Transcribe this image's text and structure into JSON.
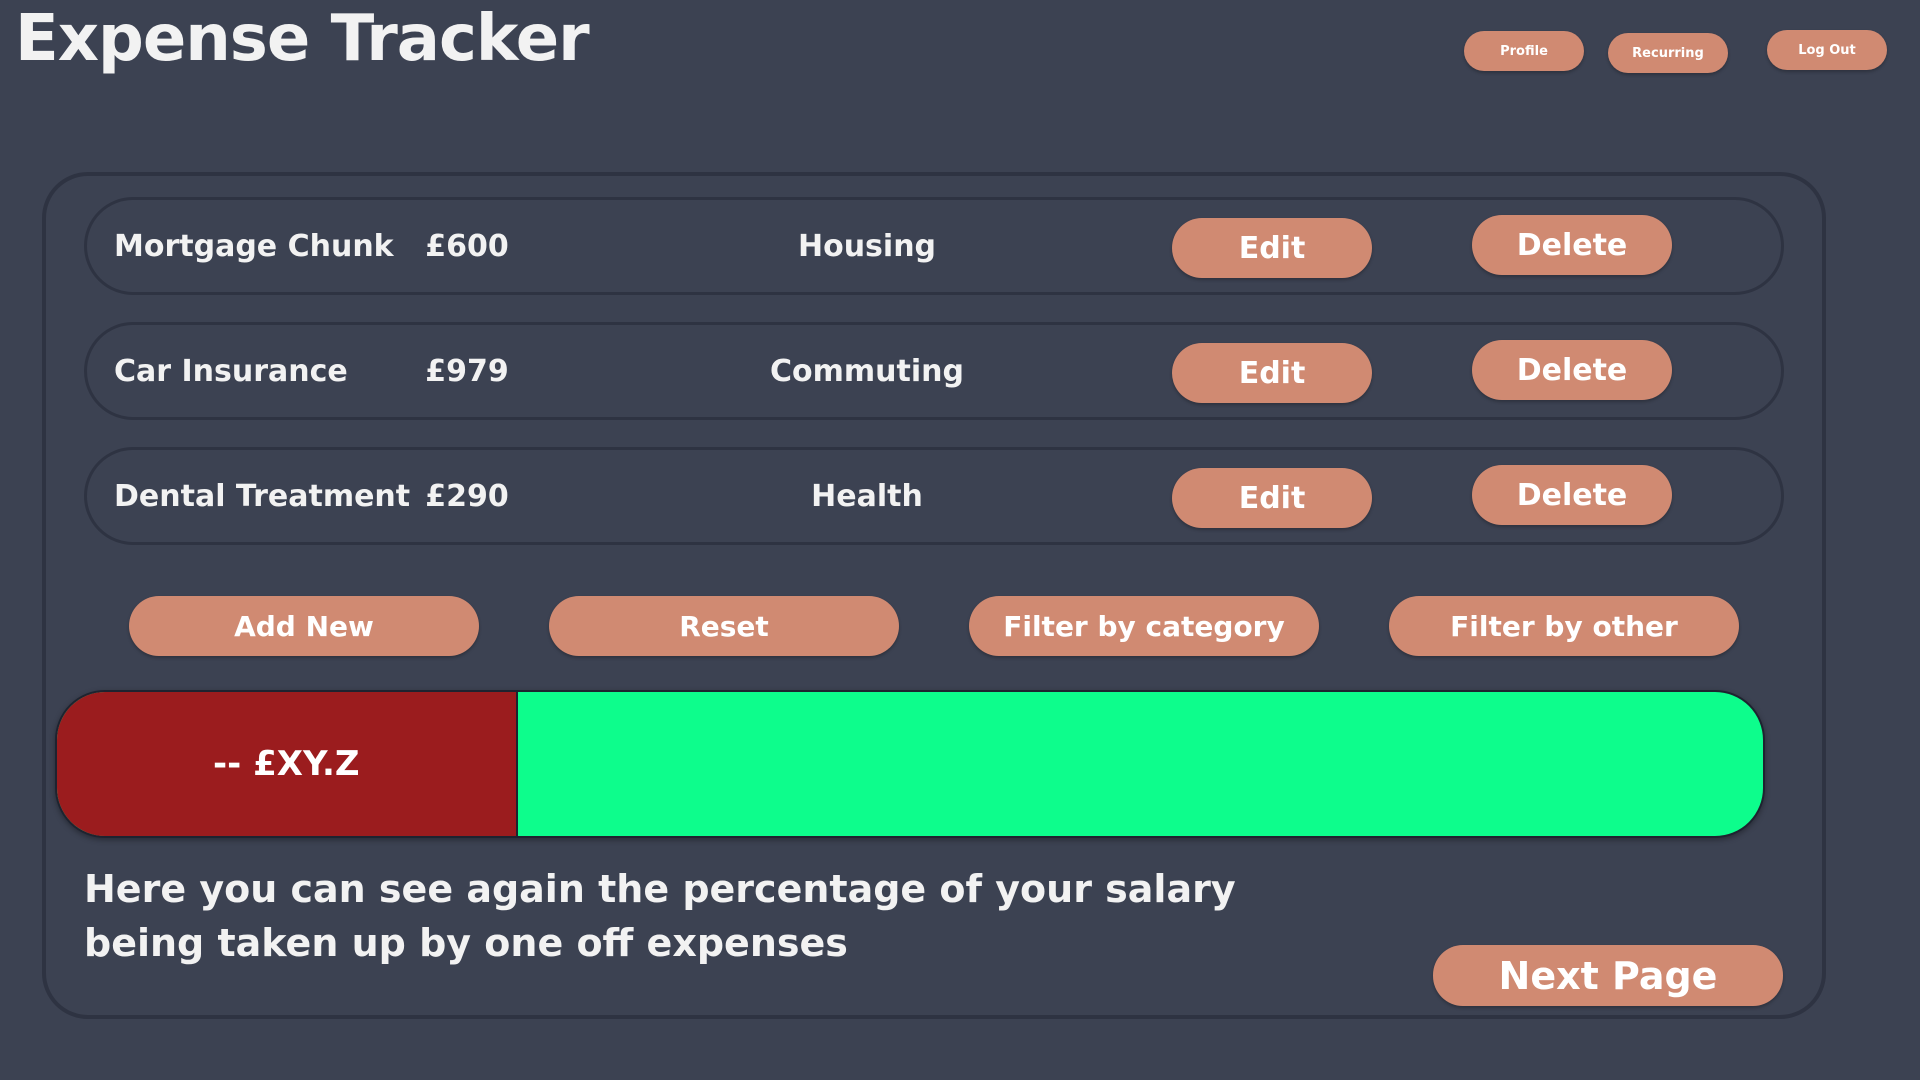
{
  "app": {
    "title": "Expense Tracker"
  },
  "header": {
    "profile_label": "Profile",
    "recurring_label": "Recurring",
    "logout_label": "Log Out"
  },
  "expenses": [
    {
      "name": "Mortgage Chunk",
      "amount": "£600",
      "category": "Housing",
      "edit_label": "Edit",
      "delete_label": "Delete"
    },
    {
      "name": "Car Insurance",
      "amount": "£979",
      "category": "Commuting",
      "edit_label": "Edit",
      "delete_label": "Delete"
    },
    {
      "name": "Dental Treatment",
      "amount": "£290",
      "category": "Health",
      "edit_label": "Edit",
      "delete_label": "Delete"
    }
  ],
  "actions": {
    "add_new_label": "Add New",
    "reset_label": "Reset",
    "filter_category_label": "Filter by category",
    "filter_other_label": "Filter by other"
  },
  "salary_bar": {
    "label": "-- £XY.Z",
    "used_fraction": 0.27,
    "used_color": "#9b1c1e",
    "remaining_color": "#0dfd8c"
  },
  "description": {
    "line1": "Here you can see again the percentage of your salary",
    "line2": "being taken up by one off expenses"
  },
  "next_page_label": "Next Page",
  "colors": {
    "background": "#3c4252",
    "button": "#d08a72",
    "border": "#2e3342",
    "text": "#f2f2f2"
  }
}
